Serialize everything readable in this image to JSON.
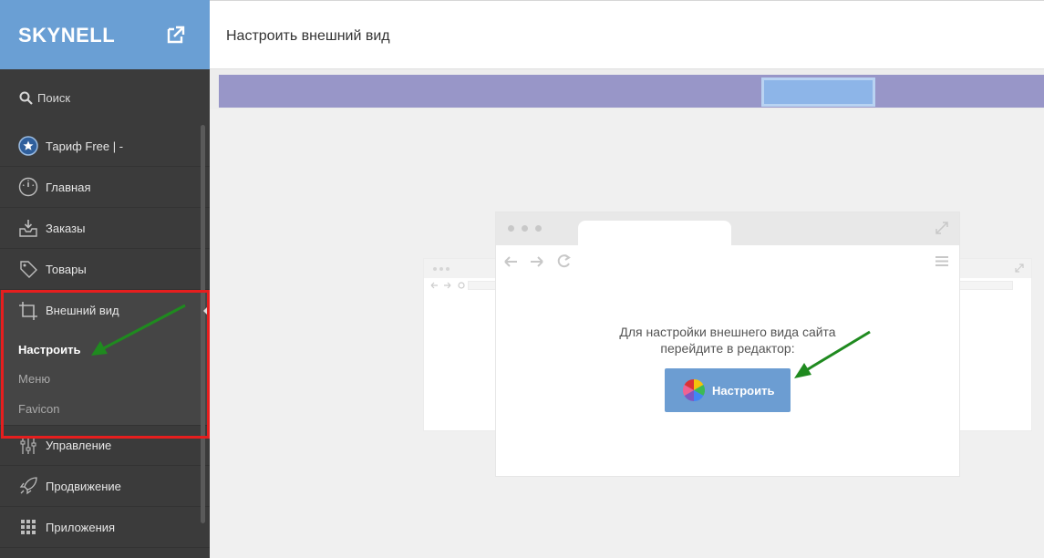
{
  "sidebar": {
    "logo": "SKYNELL",
    "search_label": "Поиск",
    "plan_label": "Тариф Free | -",
    "items": [
      {
        "label": "Главная",
        "icon": "speedometer-icon"
      },
      {
        "label": "Заказы",
        "icon": "inbox-download-icon"
      },
      {
        "label": "Товары",
        "icon": "tag-icon"
      },
      {
        "label": "Внешний вид",
        "icon": "crop-icon"
      },
      {
        "label": "Управление",
        "icon": "sliders-icon"
      },
      {
        "label": "Продвижение",
        "icon": "rocket-icon"
      },
      {
        "label": "Приложения",
        "icon": "grid-icon"
      }
    ],
    "subitems": [
      {
        "label": "Настроить",
        "active": true
      },
      {
        "label": "Меню",
        "active": false
      },
      {
        "label": "Favicon",
        "active": false
      }
    ]
  },
  "header": {
    "title": "Настроить внешний вид"
  },
  "editor": {
    "hint_line1": "Для настройки внешнего вида сайта",
    "hint_line2": "перейдите в редактор:",
    "button_label": "Настроить"
  },
  "colors": {
    "sidebar_bg": "#3b3b3b",
    "logo_bar": "#6a9fd4",
    "accent_button": "#6c9dd2",
    "highlight_frame": "#e61e1e",
    "annotation_arrow": "#1f8a1f",
    "banner": "#9896c8"
  }
}
